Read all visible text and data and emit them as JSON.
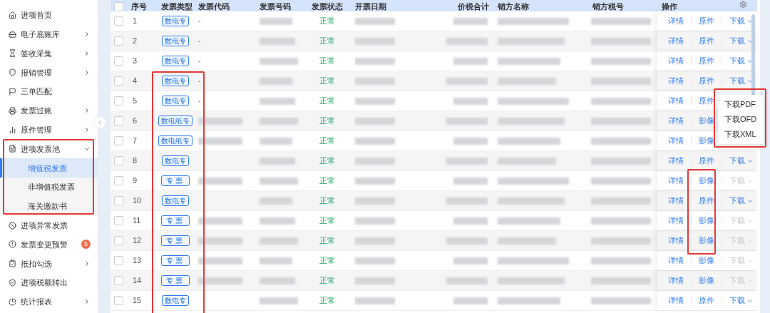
{
  "sidebar": {
    "items": [
      {
        "label": "进项首页",
        "has_children": false
      },
      {
        "label": "电子底账库",
        "has_children": true
      },
      {
        "label": "签收采集",
        "has_children": true
      },
      {
        "label": "报销管理",
        "has_children": true
      },
      {
        "label": "三单匹配",
        "has_children": false
      },
      {
        "label": "发票过账",
        "has_children": true
      },
      {
        "label": "原件管理",
        "has_children": true
      },
      {
        "label": "进项发票池",
        "has_children": true,
        "expanded": true,
        "children": [
          {
            "label": "增值税发票",
            "selected": true
          },
          {
            "label": "非增值税发票",
            "selected": false
          },
          {
            "label": "海关缴款书",
            "selected": false
          }
        ]
      },
      {
        "label": "进项异常发票",
        "has_children": false
      },
      {
        "label": "发票变更预警",
        "has_children": false,
        "badge": "5"
      },
      {
        "label": "抵扣勾选",
        "has_children": true
      },
      {
        "label": "进项税额转出",
        "has_children": false
      },
      {
        "label": "统计报表",
        "has_children": true
      }
    ]
  },
  "table": {
    "header_checked": false,
    "columns": [
      "序号",
      "发票类型",
      "发票代码",
      "发票号码",
      "发票状态",
      "开票日期",
      "价税合计",
      "销方名称",
      "销方税号",
      "操作"
    ],
    "rows": [
      {
        "checked": false,
        "index": "1",
        "type": "数电专",
        "invoice_code": "-",
        "status": "正常",
        "detail": "详情",
        "file_link": "原件",
        "download": {
          "label": "下载",
          "disabled": false
        }
      },
      {
        "checked": false,
        "index": "2",
        "type": "数电专",
        "invoice_code": "-",
        "status": "正常",
        "detail": "详情",
        "file_link": "原件",
        "download": {
          "label": "下载",
          "disabled": false
        }
      },
      {
        "checked": false,
        "index": "3",
        "type": "数电专",
        "invoice_code": "-",
        "status": "正常",
        "detail": "详情",
        "file_link": "原件",
        "download": {
          "label": "下载",
          "disabled": false
        }
      },
      {
        "checked": false,
        "index": "4",
        "type": "数电专",
        "invoice_code": "-",
        "status": "正常",
        "detail": "详情",
        "file_link": "原件",
        "download": {
          "label": "下载",
          "disabled": false
        }
      },
      {
        "checked": false,
        "index": "5",
        "type": "数电专",
        "invoice_code": "-",
        "status": "正常",
        "detail": "详情",
        "file_link": "原件"
      },
      {
        "checked": false,
        "index": "6",
        "type": "数电纸专",
        "code_redacted": true,
        "status": "正常",
        "detail": "详情",
        "file_link": "影像"
      },
      {
        "checked": false,
        "index": "7",
        "type": "数电纸专",
        "code_redacted": true,
        "status": "正常",
        "detail": "详情",
        "file_link": "影像"
      },
      {
        "checked": false,
        "index": "8",
        "type": "数电专",
        "status": "正常",
        "detail": "详情",
        "file_link": "原件",
        "download": {
          "label": "下载",
          "disabled": false
        }
      },
      {
        "checked": false,
        "index": "9",
        "type": "专票",
        "code_redacted": true,
        "status": "正常",
        "detail": "详情",
        "file_link": "影像",
        "download": {
          "label": "下载",
          "disabled": true
        }
      },
      {
        "checked": false,
        "index": "10",
        "type": "数电专",
        "status": "正常",
        "detail": "详情",
        "file_link": "原件",
        "download": {
          "label": "下载",
          "disabled": false
        }
      },
      {
        "checked": false,
        "index": "11",
        "type": "专票",
        "code_redacted": true,
        "status": "正常",
        "detail": "详情",
        "file_link": "影像",
        "download": {
          "label": "下载",
          "disabled": true
        }
      },
      {
        "checked": false,
        "index": "12",
        "type": "专票",
        "code_redacted": true,
        "status": "正常",
        "detail": "详情",
        "file_link": "影像",
        "download": {
          "label": "下载",
          "disabled": true
        }
      },
      {
        "checked": false,
        "index": "13",
        "type": "专票",
        "code_redacted": true,
        "status": "正常",
        "detail": "详情",
        "file_link": "影像",
        "download": {
          "label": "下载",
          "disabled": true
        }
      },
      {
        "checked": false,
        "index": "14",
        "type": "专票",
        "code_redacted": true,
        "status": "正常",
        "detail": "详情",
        "file_link": "影像",
        "download": {
          "label": "下载",
          "disabled": true
        }
      },
      {
        "checked": false,
        "index": "15",
        "type": "数电专",
        "status": "正常",
        "detail": "详情",
        "file_link": "原件",
        "download": {
          "label": "下载",
          "disabled": false
        }
      }
    ]
  },
  "download_menu": {
    "items": [
      "下载PDF",
      "下载OFD",
      "下载XML"
    ]
  },
  "highlights": [
    {
      "kind": "sidebar_pool"
    },
    {
      "kind": "type_column"
    },
    {
      "kind": "scan_column"
    },
    {
      "kind": "download_menu"
    }
  ]
}
